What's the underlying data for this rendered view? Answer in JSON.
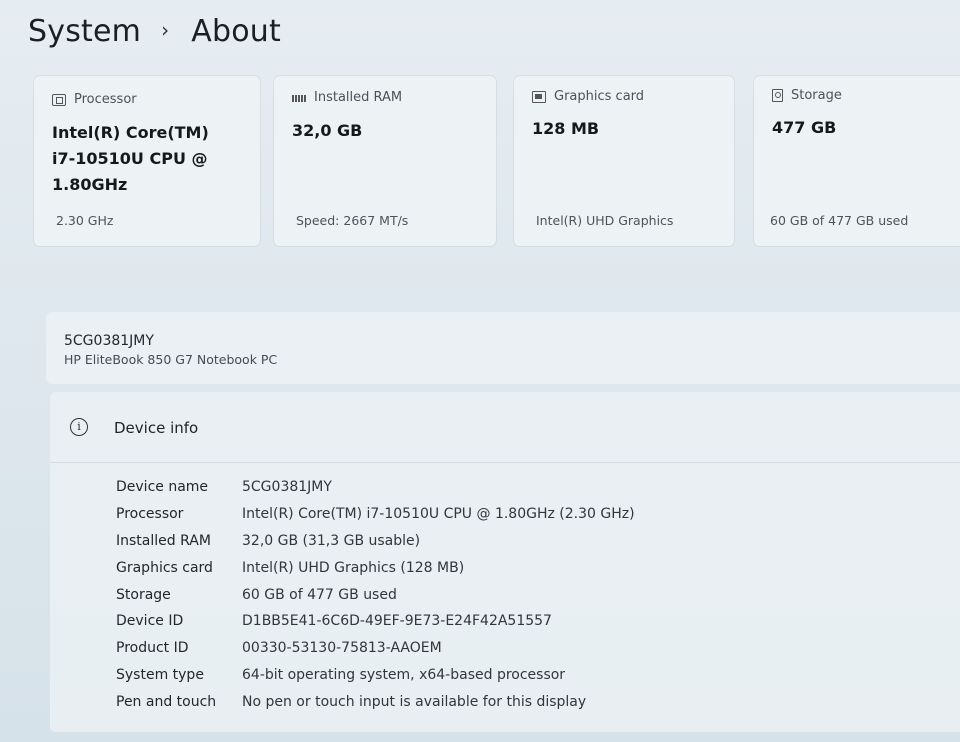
{
  "breadcrumb": {
    "parent": "System",
    "separator": "›",
    "current": "About"
  },
  "cards": [
    {
      "label": "Processor",
      "icon": "processor-icon",
      "value_lines": [
        "Intel(R) Core(TM)",
        "i7-10510U CPU @",
        "1.80GHz"
      ],
      "sub": "2.30 GHz"
    },
    {
      "label": "Installed RAM",
      "icon": "ram-icon",
      "value_lines": [
        "32,0 GB"
      ],
      "sub": "Speed: 2667 MT/s"
    },
    {
      "label": "Graphics card",
      "icon": "graphics-card-icon",
      "value_lines": [
        "128 MB"
      ],
      "sub": "Intel(R) UHD Graphics"
    },
    {
      "label": "Storage",
      "icon": "storage-icon",
      "value_lines": [
        "477 GB"
      ],
      "sub": "60 GB of 477 GB used"
    }
  ],
  "device": {
    "name": "5CG0381JMY",
    "model": "HP EliteBook 850 G7 Notebook PC"
  },
  "device_info": {
    "title": "Device info",
    "icon_glyph": "i",
    "rows": [
      {
        "key": "Device name",
        "value": "5CG0381JMY"
      },
      {
        "key": "Processor",
        "value": "Intel(R) Core(TM) i7-10510U CPU @ 1.80GHz (2.30 GHz)"
      },
      {
        "key": "Installed RAM",
        "value": "32,0 GB (31,3 GB usable)"
      },
      {
        "key": "Graphics card",
        "value": "Intel(R) UHD Graphics (128 MB)"
      },
      {
        "key": "Storage",
        "value": "60 GB of 477 GB used"
      },
      {
        "key": "Device ID",
        "value": "D1BB5E41-6C6D-49EF-9E73-E24F42A51557"
      },
      {
        "key": "Product ID",
        "value": "00330-53130-75813-AAOEM"
      },
      {
        "key": "System type",
        "value": "64-bit operating system, x64-based processor"
      },
      {
        "key": "Pen and touch",
        "value": "No pen or touch input is available for this display"
      }
    ]
  }
}
